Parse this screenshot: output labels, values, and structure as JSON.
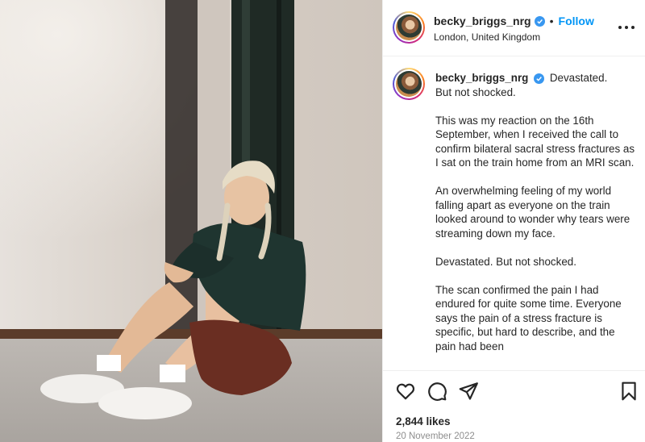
{
  "post": {
    "username": "becky_briggs_nrg",
    "follow_label": "Follow",
    "separator": "•",
    "location": "London, United Kingdom",
    "image_alt": "Woman sitting on the floor against a pillar looking at her watch"
  },
  "caption": {
    "username": "becky_briggs_nrg",
    "first_line": "Devastated.",
    "paragraphs": [
      "But not shocked.",
      "This was my reaction on the 16th September, when I received the call to confirm bilateral sacral stress fractures as I sat on the train home from an MRI scan.",
      "An overwhelming feeling of my world falling apart as everyone on the train looked around to wonder why tears were streaming down my face.",
      "Devastated. But not shocked.",
      "The scan confirmed the pain I had endured for quite some time. Everyone says the pain of a stress fracture is specific, but hard to describe, and the pain had been"
    ]
  },
  "actions": {
    "likes": "2,844 likes",
    "date": "20 November 2022"
  },
  "icons": {
    "like": "heart-icon",
    "comment": "comment-icon",
    "share": "send-icon",
    "save": "bookmark-icon",
    "more": "more-options-icon",
    "verified": "verified-badge-icon"
  },
  "colors": {
    "link": "#0095f6",
    "verified": "#3897f0",
    "text": "#262626",
    "muted": "#8e8e8e"
  }
}
